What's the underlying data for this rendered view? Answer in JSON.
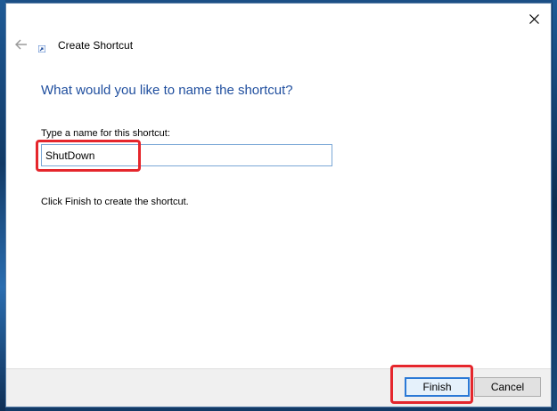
{
  "window": {
    "title": "Create Shortcut",
    "close_glyph": "✕",
    "back_glyph": "←"
  },
  "main": {
    "heading": "What would you like to name the shortcut?",
    "name_label": "Type a name for this shortcut:",
    "name_value": "ShutDown",
    "instruction": "Click Finish to create the shortcut."
  },
  "footer": {
    "finish_label": "Finish",
    "cancel_label": "Cancel"
  },
  "colors": {
    "heading": "#1f4e9e",
    "highlight": "#e5262c",
    "default_button_border": "#2b79d6"
  },
  "icons": [
    "close-icon",
    "back-arrow-icon",
    "shortcut-icon"
  ]
}
